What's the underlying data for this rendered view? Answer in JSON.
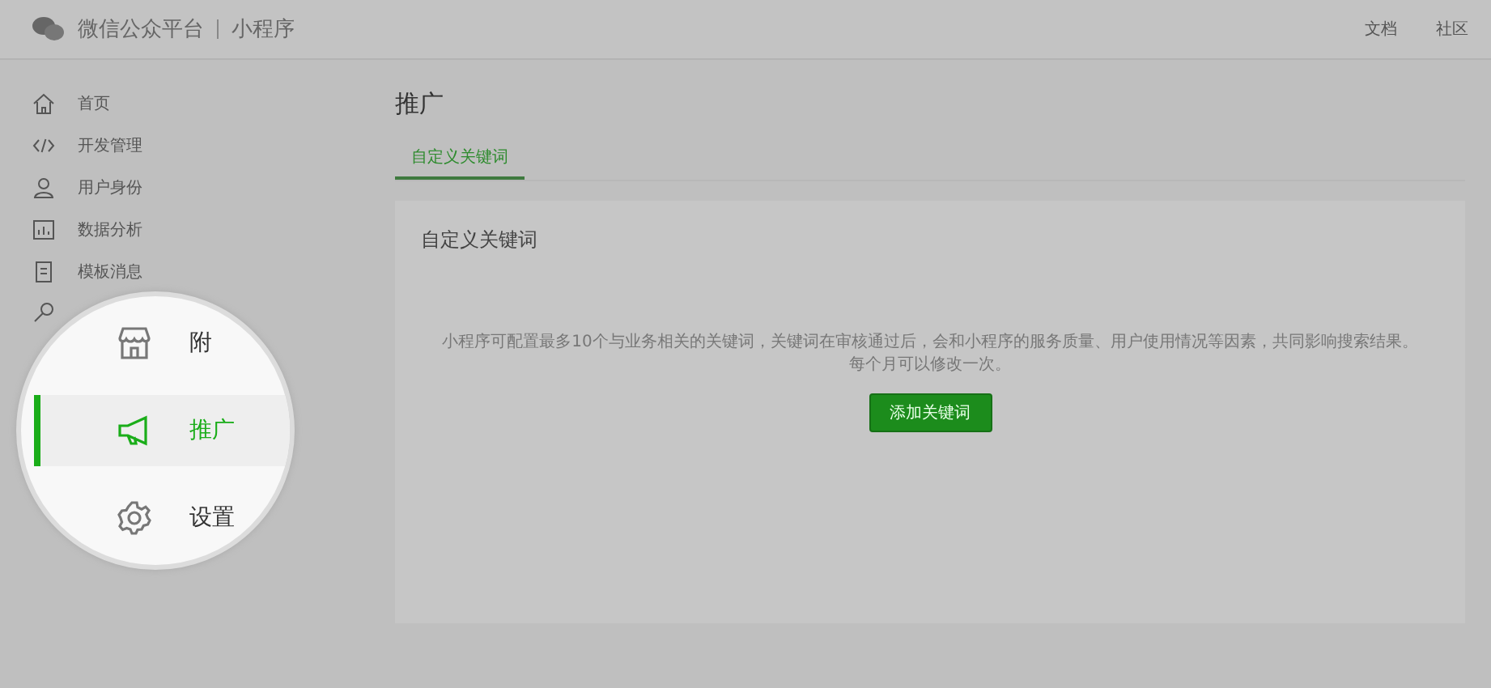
{
  "header": {
    "title": "微信公众平台",
    "product": "小程序",
    "links": [
      "文档",
      "社区"
    ]
  },
  "sidebar": {
    "items": [
      {
        "label": "首页"
      },
      {
        "label": "开发管理"
      },
      {
        "label": "用户身份"
      },
      {
        "label": "数据分析"
      },
      {
        "label": "模板消息"
      }
    ]
  },
  "magnifier": {
    "items": [
      {
        "label": "附",
        "selected": false
      },
      {
        "label": "推广",
        "selected": true
      },
      {
        "label": "设置",
        "selected": false
      }
    ]
  },
  "page": {
    "title": "推广",
    "tabs": [
      {
        "label": "自定义关键词",
        "selected": true
      }
    ],
    "panel": {
      "title": "自定义关键词",
      "description": [
        "小程序可配置最多10个与业务相关的关键词，关键词在审核通过后，会和小程序的服务质量、用户使用情况等因素，共同影响搜索结果。",
        "每个月可以修改一次。"
      ],
      "button": "添加关键词"
    }
  }
}
